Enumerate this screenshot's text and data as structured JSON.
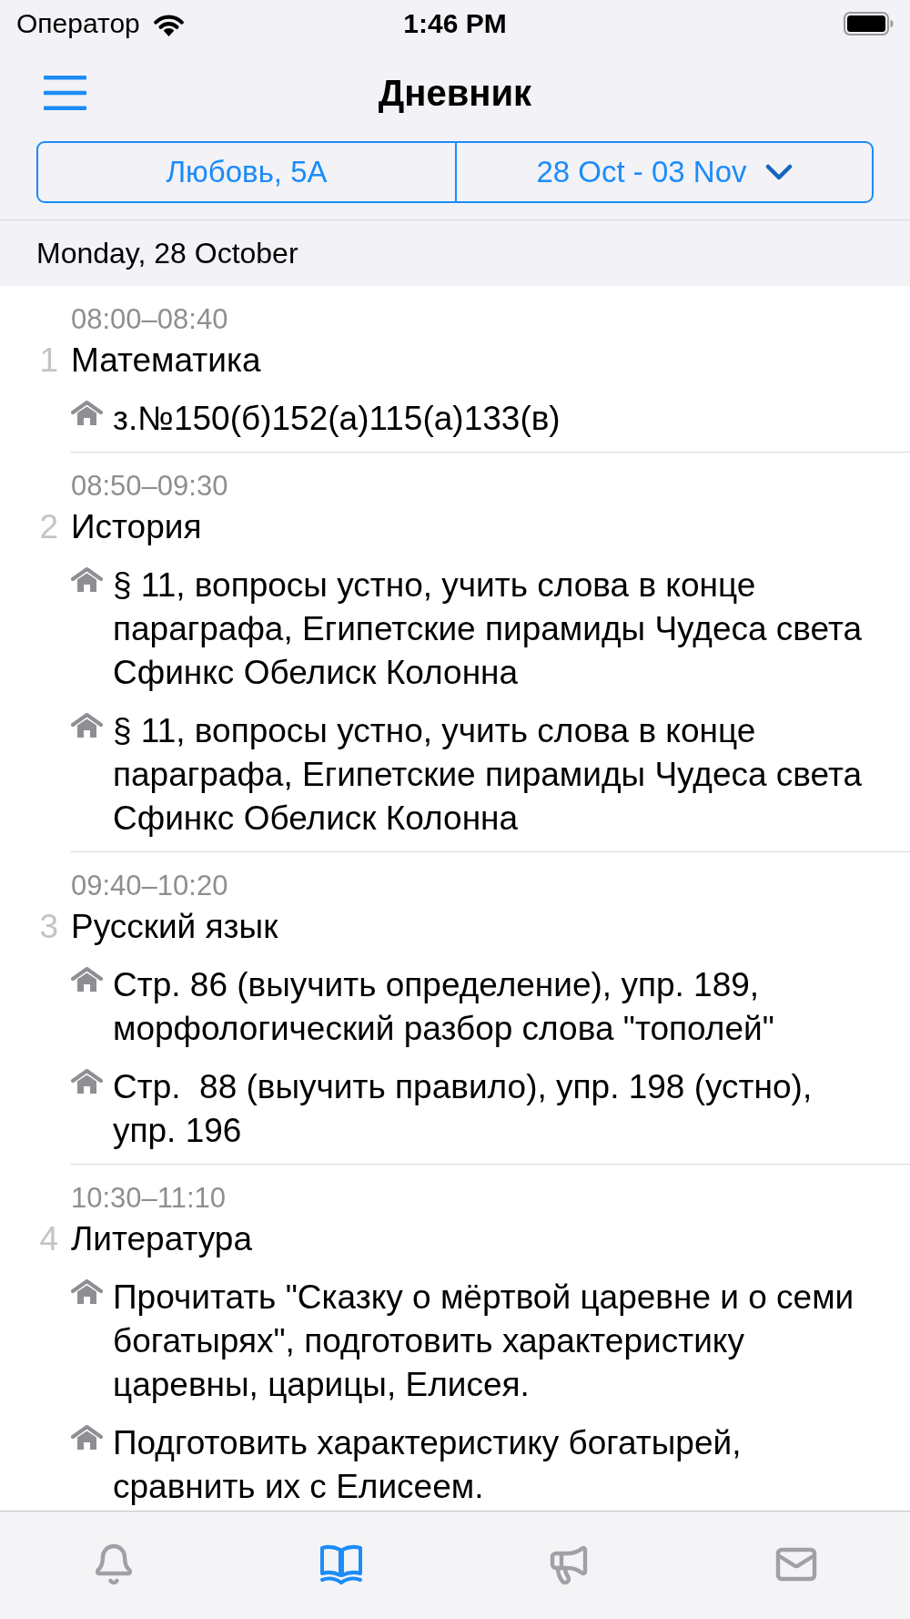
{
  "status_bar": {
    "carrier": "Оператор",
    "time": "1:46 PM"
  },
  "nav_bar": {
    "title": "Дневник"
  },
  "filters": [
    {
      "label": "Любовь, 5А",
      "kind": "plain"
    },
    {
      "label": "28 Oct - 03 Nov",
      "kind": "dropdown"
    }
  ],
  "day": {
    "header": "Monday, 28 October",
    "lessons": [
      {
        "number": "1",
        "time": "08:00–08:40",
        "subject": "Математика",
        "homework": [
          "з.№150(б)152(а)115(а)133(в)"
        ]
      },
      {
        "number": "2",
        "time": "08:50–09:30",
        "subject": "История",
        "homework": [
          "§ 11, вопросы устно, учить слова в конце параграфа, Египетские пирамиды Чудеса света Сфинкс Обелиск Колонна",
          "§ 11, вопросы устно, учить слова в конце параграфа, Египетские пирамиды Чудеса света Сфинкс Обелиск Колонна"
        ]
      },
      {
        "number": "3",
        "time": "09:40–10:20",
        "subject": "Русский язык",
        "homework": [
          "Стр. 86 (выучить определение), упр. 189, морфологический разбор слова \"тополей\"",
          "Стр.  88 (выучить правило), упр. 198 (устно), упр. 196"
        ]
      },
      {
        "number": "4",
        "time": "10:30–11:10",
        "subject": "Литература",
        "homework": [
          "Прочитать \"Сказку о мёртвой царевне и о семи богатырях\", подготовить характеристику царевны, царицы, Елисея.",
          "Подготовить характеристику богатырей, сравнить их с Елисеем."
        ]
      }
    ]
  },
  "tab_bar": {
    "tabs": [
      {
        "kind": "notifications",
        "selected": false
      },
      {
        "kind": "diary",
        "selected": true
      },
      {
        "kind": "announcements",
        "selected": false
      },
      {
        "kind": "messages",
        "selected": false
      }
    ]
  }
}
